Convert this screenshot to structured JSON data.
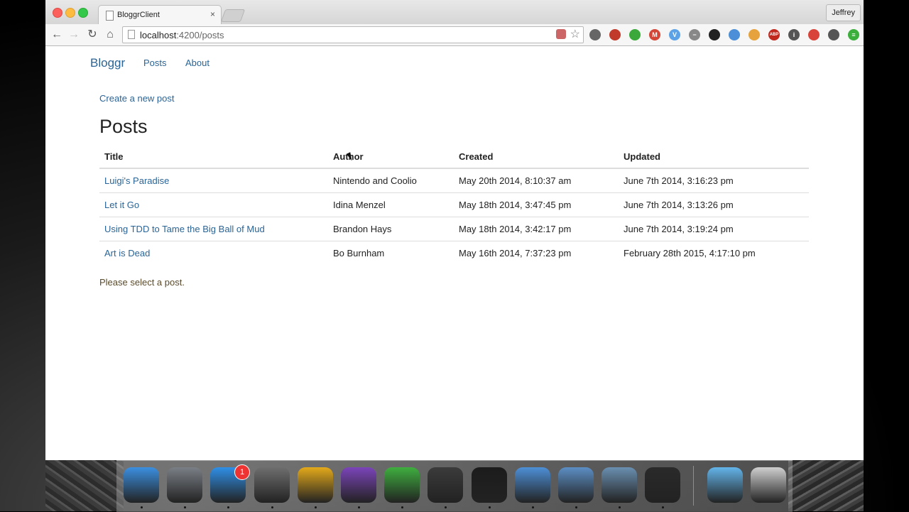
{
  "browser": {
    "tab_title": "BloggrClient",
    "tab_close": "×",
    "profile_name": "Jeffrey",
    "url_host": "localhost",
    "url_path": ":4200/posts"
  },
  "nav": {
    "brand": "Bloggr",
    "links": [
      "Posts",
      "About"
    ]
  },
  "content": {
    "create_link": "Create a new post",
    "heading": "Posts",
    "columns": [
      "Title",
      "Author",
      "Created",
      "Updated"
    ],
    "rows": [
      {
        "title": "Luigi's Paradise",
        "author": "Nintendo and Coolio",
        "created": "May 20th 2014, 8:10:37 am",
        "updated": "June 7th 2014, 3:16:23 pm"
      },
      {
        "title": "Let it Go",
        "author": "Idina Menzel",
        "created": "May 18th 2014, 3:47:45 pm",
        "updated": "June 7th 2014, 3:13:26 pm"
      },
      {
        "title": "Using TDD to Tame the Big Ball of Mud",
        "author": "Brandon Hays",
        "created": "May 18th 2014, 3:42:17 pm",
        "updated": "June 7th 2014, 3:19:24 pm"
      },
      {
        "title": "Art is Dead",
        "author": "Bo Burnham",
        "created": "May 16th 2014, 7:37:23 pm",
        "updated": "February 28th 2015, 4:17:10 pm"
      }
    ],
    "select_message": "Please select a post."
  },
  "extensions": [
    {
      "name": "eyedropper-icon",
      "label": "",
      "color": "#666666"
    },
    {
      "name": "plus-square-icon",
      "label": "",
      "color": "#c0392b"
    },
    {
      "name": "evernote-leaf-icon",
      "label": "",
      "color": "#3aa83a"
    },
    {
      "name": "gmail-icon",
      "label": "M",
      "color": "#d44638"
    },
    {
      "name": "vimium-icon",
      "label": "V",
      "color": "#5ba3e6"
    },
    {
      "name": "minus-circle-icon",
      "label": "−",
      "color": "#888888"
    },
    {
      "name": "sync-icon",
      "label": "",
      "color": "#222222"
    },
    {
      "name": "info-blue-icon",
      "label": "",
      "color": "#4a8fd8"
    },
    {
      "name": "pinwheel-icon",
      "label": "",
      "color": "#e6a23c"
    },
    {
      "name": "adblock-plus-icon",
      "label": "ABP",
      "color": "#c0281e"
    },
    {
      "name": "info-icon",
      "label": "i",
      "color": "#555555"
    },
    {
      "name": "bookmark-red-icon",
      "label": "",
      "color": "#d9443a"
    },
    {
      "name": "pocket-icon",
      "label": "",
      "color": "#555555"
    },
    {
      "name": "chrome-menu-icon",
      "label": "≡",
      "color": "#3cae3c"
    }
  ],
  "dock": {
    "badge_count": "1",
    "apps": [
      {
        "name": "finder-icon",
        "color": "#3b8fe0"
      },
      {
        "name": "launchpad-icon",
        "color": "#7a7f86"
      },
      {
        "name": "app-store-icon",
        "color": "#2f8fe6"
      },
      {
        "name": "system-preferences-icon",
        "color": "#6e6e6e"
      },
      {
        "name": "chrome-icon",
        "color": "#e3a91a"
      },
      {
        "name": "dash-icon",
        "color": "#7b44b8"
      },
      {
        "name": "evernote-icon",
        "color": "#3fae3f"
      },
      {
        "name": "sublime-text-icon",
        "color": "#3b3b3b"
      },
      {
        "name": "terminal-icon",
        "color": "#1c1c1c"
      },
      {
        "name": "keynote-icon",
        "color": "#4d8fd6"
      },
      {
        "name": "screenflow-icon",
        "color": "#5c8ec4"
      },
      {
        "name": "numbers-calculator-icon",
        "color": "#6a8fb0"
      },
      {
        "name": "quicktime-icon",
        "color": "#2a2a2a"
      },
      {
        "name": "downloads-folder-icon",
        "color": "#63b4ea"
      },
      {
        "name": "trash-icon",
        "color": "#cfcfcf"
      }
    ]
  }
}
